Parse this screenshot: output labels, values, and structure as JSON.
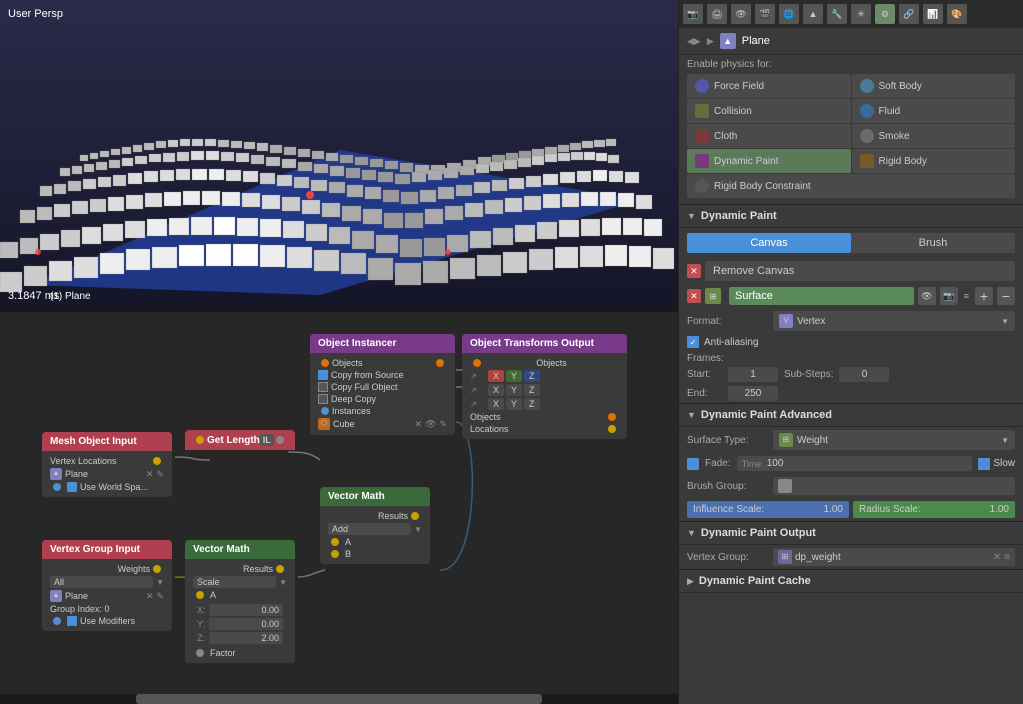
{
  "viewport": {
    "label": "User Persp",
    "time": "3.1847 ms",
    "plane_label": "(1) Plane"
  },
  "physics": {
    "title": "Enable physics for:",
    "buttons": [
      {
        "id": "force-field",
        "label": "Force Field",
        "icon": "⊕",
        "active": false
      },
      {
        "id": "soft-body",
        "label": "Soft Body",
        "icon": "◎",
        "active": false
      },
      {
        "id": "collision",
        "label": "Collision",
        "icon": "⬡",
        "active": false
      },
      {
        "id": "fluid",
        "label": "Fluid",
        "icon": "💧",
        "active": false
      },
      {
        "id": "cloth",
        "label": "Cloth",
        "icon": "🔘",
        "active": false
      },
      {
        "id": "smoke",
        "label": "Smoke",
        "icon": "☁",
        "active": false
      },
      {
        "id": "dynamic-paint",
        "label": "Dynamic Paint",
        "icon": "🖌",
        "active": true
      },
      {
        "id": "rigid-body",
        "label": "Rigid Body",
        "icon": "⬡",
        "active": false
      },
      {
        "id": "rigid-body-constraint",
        "label": "Rigid Body Constraint",
        "icon": "🔗",
        "active": false
      }
    ]
  },
  "object": {
    "name": "Plane",
    "icon": "▲"
  },
  "dynamic_paint": {
    "section_title": "Dynamic Paint",
    "tab_canvas": "Canvas",
    "tab_brush": "Brush",
    "remove_canvas": "Remove Canvas",
    "surface_name": "Surface",
    "format_label": "Format:",
    "format_value": "Vertex",
    "anti_aliasing": "Anti-aliasing",
    "frames_title": "Frames:",
    "start_label": "Start:",
    "start_value": "1",
    "substeps_label": "Sub-Steps:",
    "substeps_value": "0",
    "end_label": "End:",
    "end_value": "250"
  },
  "advanced": {
    "section_title": "Dynamic Paint Advanced",
    "surface_type_label": "Surface Type:",
    "surface_type_value": "Weight",
    "fade_label": "Fade:",
    "time_label": "Time:",
    "time_value": "100",
    "slow_label": "Slow",
    "brush_group_label": "Brush Group:",
    "influence_scale_label": "Influence Scale:",
    "influence_scale_value": "1.00",
    "radius_scale_label": "Radius Scale:",
    "radius_scale_value": "1.00"
  },
  "output": {
    "section_title": "Dynamic Paint Output",
    "vertex_group_label": "Vertex Group:",
    "vertex_group_value": "dp_weight"
  },
  "cache": {
    "section_title": "Dynamic Paint Cache"
  },
  "nodes": {
    "mesh_object_input": {
      "title": "Mesh Object Input",
      "output": "Vertex Locations",
      "field_plane": "Plane",
      "field_use_world": "Use World Spa..."
    },
    "get_length": {
      "title": "Get Length"
    },
    "object_instancer": {
      "title": "Object Instancer",
      "input": "Objects",
      "copy_from_source": "Copy from Source",
      "copy_full_object": "Copy Full Object",
      "deep_copy": "Deep Copy",
      "instances": "Instances",
      "field_cube": "Cube"
    },
    "object_transforms": {
      "title": "Object Transforms Output",
      "input": "Objects",
      "x": "X",
      "y": "Y",
      "z": "Z",
      "output": "Objects",
      "locations": "Locations"
    },
    "vertex_group_input": {
      "title": "Vertex Group Input",
      "output": "Weights",
      "field_all": "All",
      "field_plane": "Plane",
      "group_index": "Group Index: 0",
      "use_modifiers": "Use Modifiers"
    },
    "vector_math_1": {
      "title": "Vector Math",
      "output": "Results",
      "op": "Scale",
      "a": "A",
      "x": "0.00",
      "y": "0.00",
      "z": "2.00",
      "factor": "Factor"
    },
    "vector_math_2": {
      "title": "Vector Math",
      "output": "Results",
      "op": "Add",
      "a": "A",
      "b": "B"
    }
  }
}
